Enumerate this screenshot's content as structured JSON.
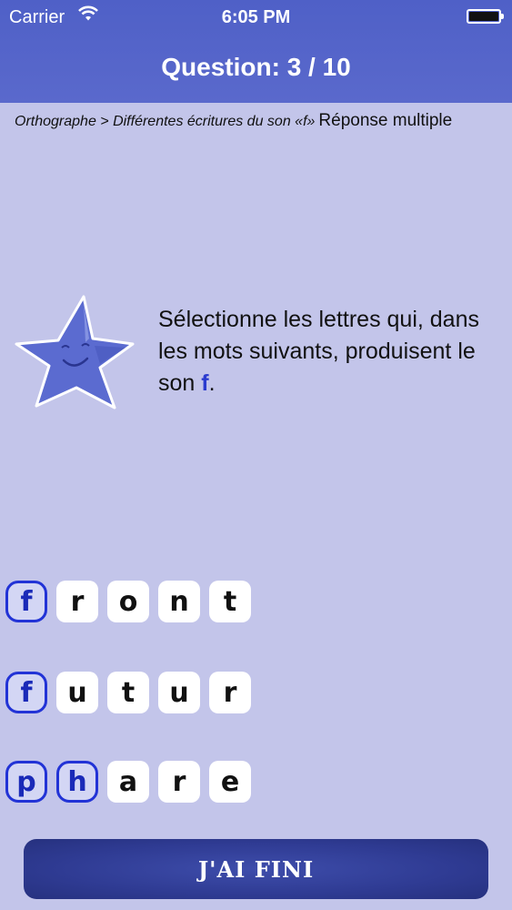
{
  "status_bar": {
    "carrier": "Carrier",
    "time": "6:05 PM"
  },
  "header": {
    "title": "Question: 3 / 10"
  },
  "breadcrumb": {
    "path": "Orthographe > Différentes écritures du son «f»",
    "question_type": "Réponse multiple"
  },
  "instruction": {
    "text": "Sélectionne les lettres qui, dans les mots suivants, produisent le son ",
    "sound": "f",
    "end": "."
  },
  "words": [
    {
      "letters": [
        {
          "char": "f",
          "selected": true
        },
        {
          "char": "r",
          "selected": false
        },
        {
          "char": "o",
          "selected": false
        },
        {
          "char": "n",
          "selected": false
        },
        {
          "char": "t",
          "selected": false
        }
      ]
    },
    {
      "letters": [
        {
          "char": "f",
          "selected": true
        },
        {
          "char": "u",
          "selected": false
        },
        {
          "char": "t",
          "selected": false
        },
        {
          "char": "u",
          "selected": false
        },
        {
          "char": "r",
          "selected": false
        }
      ]
    },
    {
      "letters": [
        {
          "char": "p",
          "selected": true
        },
        {
          "char": "h",
          "selected": true
        },
        {
          "char": "a",
          "selected": false
        },
        {
          "char": "r",
          "selected": false
        },
        {
          "char": "e",
          "selected": false
        }
      ]
    }
  ],
  "finish_button": {
    "label": "J'AI FINI"
  },
  "colors": {
    "header": "#5563c9",
    "background": "#c3c5ea",
    "accent": "#2233d6",
    "button": "#2f3b93"
  }
}
